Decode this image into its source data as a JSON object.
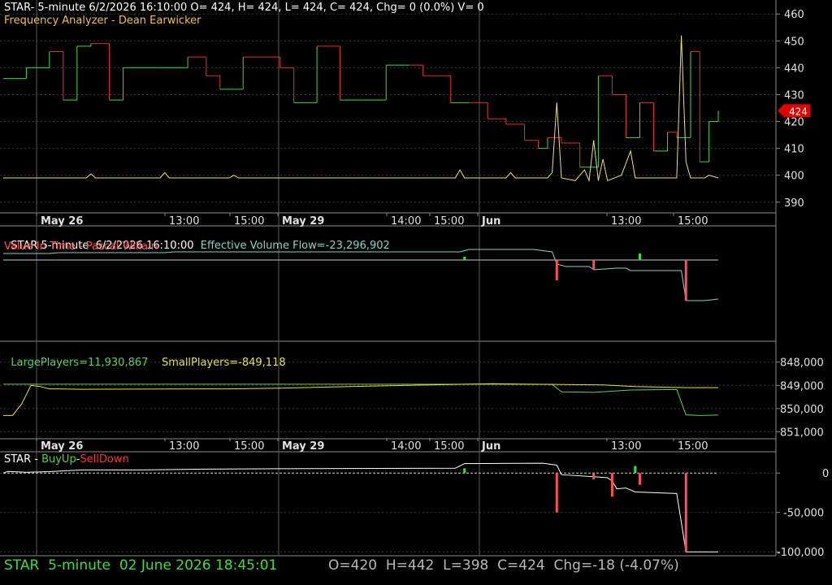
{
  "colors": {
    "background": "#000000",
    "grid": "#3a3a3a",
    "separator": "#8a8a8a",
    "axis_text": "#e0e0e0",
    "header_white": "#ffffff",
    "price_up": "#3cdc3c",
    "price_down": "#e03030",
    "analyzer_yellow": "#f0e070",
    "flow_cyan": "#7fd6c8",
    "value_in_time_red": "#ff5050",
    "large_green": "#5ad25a",
    "small_yellow": "#e8e040",
    "white_line": "#ffffff",
    "price_badge": "#e00000"
  },
  "panels": {
    "price": {
      "header_line1": "STAR- 5-minute 6/2/2026 16:10:00 O= 424, H= 424, L= 424, C= 424, Chg= 0 (0.0%) V= 0",
      "header_line2": "Frequency Analyzer - Dean Earwicker",
      "y_ticks": [
        "460",
        "450",
        "440",
        "430",
        "420",
        "410",
        "400",
        "390"
      ],
      "last_price_badge": "424"
    },
    "flow": {
      "header_title": "STAR 5-minute  6/2/2026 16:10:00",
      "header_flow": "Effective Volume Flow=-23,296,902",
      "header_line2": "Value In Time - Pascal Willain"
    },
    "players": {
      "large_label": "LargePlayers=11,930,867",
      "small_label": "SmallPlayers=-849,118",
      "y_ticks": [
        "848,000",
        "849,000",
        "850,000",
        "851,000"
      ]
    },
    "buyup": {
      "title_prefix": "STAR - ",
      "buy_label": "BuyUp",
      "dash": "-",
      "sell_label": "SellDown",
      "y_ticks": [
        "0",
        "-50,000",
        "-100,000"
      ]
    }
  },
  "time_axis_labels": [
    "May 26",
    "13:00",
    "15:00",
    "May 29",
    "14:00",
    "15:00",
    "Jun",
    "13:00",
    "15:00"
  ],
  "status": {
    "symbol": "STAR",
    "interval": "5-minute",
    "datetime": "02 June 2026 18:45:01",
    "ohlc": "O=420  H=442  L=398  C=424  Chg=-18 (-4.07%)"
  },
  "chart_data": [
    {
      "type": "line",
      "title": "Frequency Analyzer - Dean Earwicker",
      "ylim": [
        386,
        464
      ],
      "y_ticks": [
        460,
        450,
        440,
        430,
        420,
        410,
        400,
        390
      ],
      "series": [
        {
          "name": "STAR",
          "style": "step",
          "points": [
            [
              0,
              436
            ],
            [
              5,
              440
            ],
            [
              10,
              446
            ],
            [
              13,
              428
            ],
            [
              16,
              448
            ],
            [
              19,
              449
            ],
            [
              23,
              428
            ],
            [
              26,
              440
            ],
            [
              40,
              444
            ],
            [
              44,
              437
            ],
            [
              47,
              432
            ],
            [
              52,
              444
            ],
            [
              60,
              440
            ],
            [
              63,
              427
            ],
            [
              68,
              448
            ],
            [
              73,
              428
            ],
            [
              77,
              428
            ],
            [
              83,
              441
            ],
            [
              88,
              441
            ],
            [
              91,
              437
            ],
            [
              97,
              427
            ],
            [
              101,
              427
            ],
            [
              105,
              421
            ],
            [
              109,
              419
            ],
            [
              113,
              413
            ],
            [
              116,
              410
            ],
            [
              118,
              414
            ],
            [
              121,
              412
            ],
            [
              125,
              403
            ],
            [
              129,
              437
            ],
            [
              132,
              430
            ],
            [
              135,
              414
            ],
            [
              138,
              427
            ],
            [
              141,
              409
            ],
            [
              144,
              416
            ],
            [
              146,
              414
            ],
            [
              149,
              446
            ],
            [
              151,
              405
            ],
            [
              153,
              420
            ],
            [
              155,
              424
            ]
          ]
        },
        {
          "name": "Frequency Analyzer",
          "points": [
            [
              0,
              399
            ],
            [
              18,
              399
            ],
            [
              19,
              400.5
            ],
            [
              20,
              399
            ],
            [
              34,
              399
            ],
            [
              35,
              401
            ],
            [
              36,
              399
            ],
            [
              48,
              399
            ],
            [
              49,
              399
            ],
            [
              50,
              400
            ],
            [
              51,
              399
            ],
            [
              58,
              399
            ],
            [
              59,
              399
            ],
            [
              60,
              399
            ],
            [
              62,
              399
            ],
            [
              98,
              399
            ],
            [
              99,
              402
            ],
            [
              100,
              399
            ],
            [
              109,
              399
            ],
            [
              110,
              401
            ],
            [
              111,
              399
            ],
            [
              118,
              399
            ],
            [
              119,
              401
            ],
            [
              120,
              427
            ],
            [
              121,
              399
            ],
            [
              124,
              398
            ],
            [
              126,
              402
            ],
            [
              127,
              398
            ],
            [
              128,
              413
            ],
            [
              129,
              398
            ],
            [
              130,
              406
            ],
            [
              131,
              398
            ],
            [
              134,
              400
            ],
            [
              136,
              409
            ],
            [
              137,
              399
            ],
            [
              146,
              399
            ],
            [
              147,
              452
            ],
            [
              148,
              405
            ],
            [
              149,
              399
            ],
            [
              152,
              399
            ],
            [
              153,
              400
            ],
            [
              155,
              399
            ]
          ]
        }
      ]
    },
    {
      "type": "line",
      "title": "Value In Time - Pascal Willain",
      "ylim": [
        -100,
        40
      ],
      "series": [
        {
          "name": "Effective Volume Flow",
          "points": [
            [
              0,
              8
            ],
            [
              10,
              8
            ],
            [
              12,
              9
            ],
            [
              17,
              9
            ],
            [
              35,
              9
            ],
            [
              37,
              10
            ],
            [
              99,
              10
            ],
            [
              101,
              13
            ],
            [
              115,
              13
            ],
            [
              119,
              10
            ],
            [
              120,
              -5
            ],
            [
              122,
              -8
            ],
            [
              127,
              -8
            ],
            [
              128,
              -12
            ],
            [
              133,
              -10
            ],
            [
              135,
              -10
            ],
            [
              136,
              -13
            ],
            [
              147,
              -13
            ],
            [
              148,
              -50
            ],
            [
              152,
              -50
            ],
            [
              155,
              -48
            ]
          ]
        }
      ]
    },
    {
      "type": "line",
      "title": "LargePlayers / SmallPlayers",
      "ylim": [
        851300,
        847800
      ],
      "y_ticks": [
        848000,
        849000,
        850000,
        851000
      ],
      "series": [
        {
          "name": "LargePlayers",
          "points": [
            [
              0,
              848950
            ],
            [
              30,
              848950
            ],
            [
              60,
              848950
            ],
            [
              90,
              848950
            ],
            [
              104,
              848950
            ],
            [
              119,
              848960
            ],
            [
              121,
              849280
            ],
            [
              128,
              849300
            ],
            [
              136,
              849200
            ],
            [
              146,
              849180
            ],
            [
              148,
              850270
            ],
            [
              151,
              850300
            ],
            [
              155,
              850280
            ]
          ]
        },
        {
          "name": "SmallPlayers",
          "points": [
            [
              0,
              850300
            ],
            [
              2,
              850300
            ],
            [
              4,
              849800
            ],
            [
              6,
              849000
            ],
            [
              8,
              849050
            ],
            [
              10,
              849150
            ],
            [
              12,
              849150
            ],
            [
              17,
              849170
            ],
            [
              42,
              849150
            ],
            [
              49,
              849150
            ],
            [
              60,
              849120
            ],
            [
              82,
              849020
            ],
            [
              106,
              848930
            ],
            [
              115,
              848950
            ],
            [
              130,
              848980
            ],
            [
              137,
              849050
            ],
            [
              148,
              849100
            ],
            [
              155,
              849100
            ]
          ]
        }
      ]
    },
    {
      "type": "line",
      "title": "BuyUp-SellDown",
      "ylim": [
        -105000,
        25000
      ],
      "y_ticks": [
        0,
        -50000,
        -100000
      ],
      "series": [
        {
          "name": "BuyUp",
          "points": [
            [
              0,
              0
            ],
            [
              1,
              2000
            ],
            [
              5,
              1000
            ],
            [
              10,
              1800
            ],
            [
              17,
              4000
            ],
            [
              30,
              4000
            ],
            [
              44,
              5000
            ],
            [
              60,
              5500
            ],
            [
              98,
              6200
            ],
            [
              100,
              12000
            ],
            [
              117,
              12500
            ],
            [
              120,
              10000
            ],
            [
              121,
              -2000
            ],
            [
              129,
              -5000
            ],
            [
              131,
              -6000
            ],
            [
              132,
              -10000
            ],
            [
              133,
              -20000
            ],
            [
              135,
              -19000
            ],
            [
              137,
              -24000
            ],
            [
              146,
              -26000
            ],
            [
              148,
              -100000
            ],
            [
              152,
              -100000
            ],
            [
              155,
              -100000
            ]
          ]
        }
      ]
    }
  ]
}
